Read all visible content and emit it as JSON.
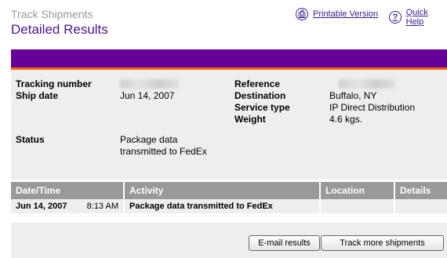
{
  "header": {
    "kicker": "Track Shipments",
    "title": "Detailed Results",
    "printable_label": "Printable Version",
    "help_label": "Quick Help"
  },
  "details": {
    "tracking_number_label": "Tracking number",
    "ship_date_label": "Ship date",
    "ship_date_value": "Jun 14, 2007",
    "reference_label": "Reference",
    "destination_label": "Destination",
    "destination_value": "Buffalo, NY",
    "service_type_label": "Service type",
    "service_type_value": "IP Direct Distribution",
    "weight_label": "Weight",
    "weight_value": "4.6 kgs.",
    "status_label": "Status",
    "status_line1": "Package data",
    "status_line2": "transmitted to FedEx"
  },
  "table": {
    "headers": [
      "Date/Time",
      "Activity",
      "Location",
      "Details"
    ],
    "rows": [
      {
        "date": "Jun 14, 2007",
        "time": "8:13 AM",
        "activity": "Package data transmitted to FedEx",
        "location": "",
        "details": ""
      }
    ]
  },
  "footer": {
    "email_label": "E-mail results",
    "track_more_label": "Track more shipments"
  },
  "colors": {
    "brand_purple": "#660099",
    "accent_orange": "#ff6600"
  },
  "icons": {
    "print": "printer-icon",
    "help": "help-icon"
  }
}
